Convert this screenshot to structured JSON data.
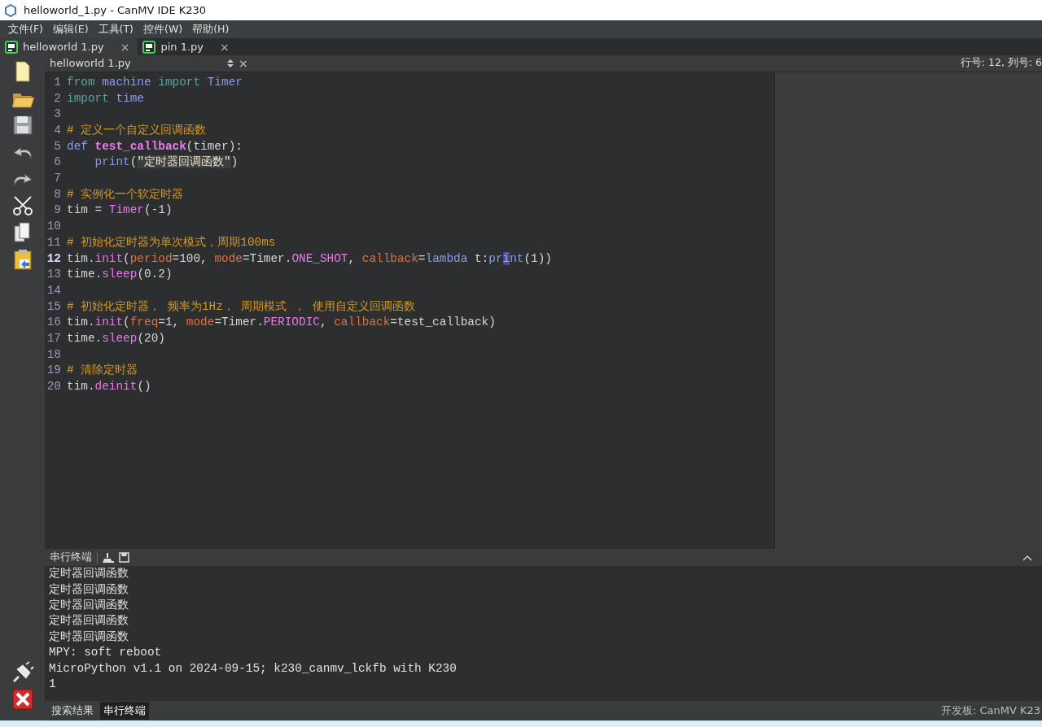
{
  "window": {
    "title": "helloworld_1.py - CanMV IDE K230"
  },
  "menu": [
    "文件(F)",
    "编辑(E)",
    "工具(T)",
    "控件(W)",
    "帮助(H)"
  ],
  "tabs": [
    {
      "label": "helloworld 1.py",
      "close": "×",
      "selected": true
    },
    {
      "label": "pin 1.py",
      "close": "×",
      "selected": false
    }
  ],
  "editor_header": {
    "file": "helloworld 1.py",
    "close": "×",
    "position": "行号: 12, 列号: 6"
  },
  "toolbar": [
    {
      "kind": "new"
    },
    {
      "kind": "open"
    },
    {
      "kind": "save"
    },
    {
      "kind": "undo"
    },
    {
      "kind": "redo"
    },
    {
      "kind": "cut"
    },
    {
      "kind": "copy"
    },
    {
      "kind": "paste"
    }
  ],
  "toolbar_bottom": [
    {
      "kind": "connect"
    },
    {
      "kind": "stop"
    }
  ],
  "code": [
    {
      "number": "1",
      "current": false,
      "tokens": [
        {
          "text": "from ",
          "color": "#55a8a0"
        },
        {
          "text": "machine ",
          "color": "#8d9be6"
        },
        {
          "text": "import ",
          "color": "#55a8a0"
        },
        {
          "text": "Timer",
          "color": "#8d9be6"
        }
      ]
    },
    {
      "number": "2",
      "current": false,
      "tokens": [
        {
          "text": "import ",
          "color": "#55a8a0"
        },
        {
          "text": "time",
          "color": "#8d9be6"
        }
      ]
    },
    {
      "number": "3",
      "current": false
    },
    {
      "number": "4",
      "current": false,
      "tokens": [
        {
          "text": "# 定义一个自定义回调函数",
          "color": "#d39a22"
        }
      ]
    },
    {
      "number": "5",
      "current": false,
      "tokens": [
        {
          "text": "def ",
          "color": "#8d9be6"
        },
        {
          "text": "test_callback",
          "color": "#ef78ef",
          "bold": true
        },
        {
          "text": "(timer):"
        }
      ]
    },
    {
      "number": "6",
      "current": false,
      "tokens": [
        {
          "text": "    print",
          "color": "#8d9be6"
        },
        {
          "text": "("
        },
        {
          "text": "\"定时器回调函数\"",
          "color": "#e8e0c8",
          "highlighted": true
        },
        {
          "text": ")"
        }
      ]
    },
    {
      "number": "7",
      "current": false
    },
    {
      "number": "8",
      "current": false,
      "tokens": [
        {
          "text": "# 实例化一个软定时器",
          "color": "#d39a22"
        }
      ]
    },
    {
      "number": "9",
      "current": false,
      "tokens": [
        {
          "text": "tim = "
        },
        {
          "text": "Timer",
          "color": "#e67ae6"
        },
        {
          "text": "(-1)"
        }
      ]
    },
    {
      "number": "10",
      "current": false
    },
    {
      "number": "11",
      "current": false,
      "tokens": [
        {
          "text": "# 初始化定时器为单次模式，周期100ms",
          "color": "#d39a22"
        }
      ]
    },
    {
      "number": "12",
      "current": true,
      "tokens": [
        {
          "text": "tim."
        },
        {
          "text": "init",
          "color": "#e67ae6"
        },
        {
          "text": "("
        },
        {
          "text": "period",
          "color": "#e0723c"
        },
        {
          "text": "=100, "
        },
        {
          "text": "mode",
          "color": "#e0723c"
        },
        {
          "text": "=Timer."
        },
        {
          "text": "ONE_SHOT",
          "color": "#e67ae6"
        },
        {
          "text": ", "
        },
        {
          "text": "callback",
          "color": "#e0723c"
        },
        {
          "text": "="
        },
        {
          "text": "lambda",
          "color": "#8d9be6"
        },
        {
          "text": " t:"
        },
        {
          "text": "pr",
          "color": "#8d9be6"
        },
        {
          "text": "i",
          "cursor": true
        },
        {
          "text": "nt",
          "color": "#8d9be6"
        },
        {
          "text": "(1))"
        }
      ]
    },
    {
      "number": "13",
      "current": false,
      "tokens": [
        {
          "text": "time."
        },
        {
          "text": "sleep",
          "color": "#e67ae6"
        },
        {
          "text": "(0.2)"
        }
      ]
    },
    {
      "number": "14",
      "current": false
    },
    {
      "number": "15",
      "current": false,
      "tokens": [
        {
          "text": "# 初始化定时器， 频率为1Hz， 周期模式 ， 使用自定义回调函数",
          "color": "#d39a22"
        }
      ]
    },
    {
      "number": "16",
      "current": false,
      "tokens": [
        {
          "text": "tim."
        },
        {
          "text": "init",
          "color": "#e67ae6"
        },
        {
          "text": "("
        },
        {
          "text": "freq",
          "color": "#e0723c"
        },
        {
          "text": "=1, "
        },
        {
          "text": "mode",
          "color": "#e0723c"
        },
        {
          "text": "=Timer."
        },
        {
          "text": "PERIODIC",
          "color": "#e67ae6"
        },
        {
          "text": ", "
        },
        {
          "text": "callback",
          "color": "#e0723c"
        },
        {
          "text": "=test_callback)"
        }
      ]
    },
    {
      "number": "17",
      "current": false,
      "tokens": [
        {
          "text": "time."
        },
        {
          "text": "sleep",
          "color": "#e67ae6"
        },
        {
          "text": "(20)"
        }
      ]
    },
    {
      "number": "18",
      "current": false
    },
    {
      "number": "19",
      "current": false,
      "tokens": [
        {
          "text": "# 清除定时器",
          "color": "#d39a22"
        }
      ]
    },
    {
      "number": "20",
      "current": false,
      "tokens": [
        {
          "text": "tim."
        },
        {
          "text": "deinit",
          "color": "#e67ae6"
        },
        {
          "text": "()"
        }
      ]
    }
  ],
  "terminal": {
    "title": "串行终端",
    "lines": [
      "定时器回调函数",
      "定时器回调函数",
      "定时器回调函数",
      "定时器回调函数",
      "定时器回调函数",
      "MPY: soft reboot",
      "MicroPython v1.1 on 2024-09-15; k230_canmv_lckfb with K230",
      "1"
    ]
  },
  "bottom_tabs": [
    {
      "label": "搜索结果",
      "selected": false
    },
    {
      "label": "串行终端",
      "selected": true
    }
  ],
  "status_bar": {
    "board": "开发板: CanMV K23"
  }
}
